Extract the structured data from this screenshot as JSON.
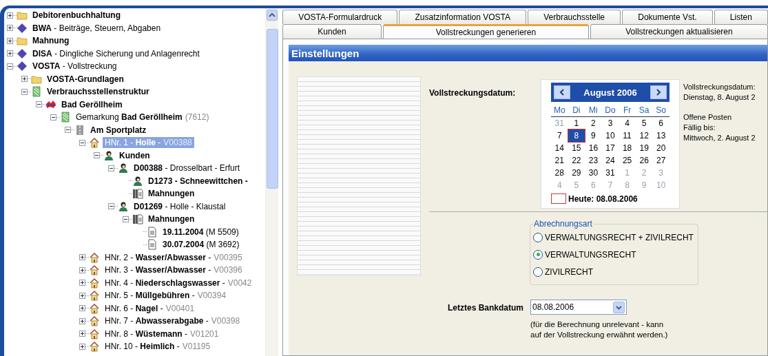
{
  "tree": {
    "items": [
      {
        "kind": "folder",
        "label": "Debitorenbuchhaltung",
        "bold": true,
        "expanded": false,
        "selected": false
      },
      {
        "kind": "diamond",
        "label": "**BWA** - Beiträge, Steuern, Abgaben",
        "expanded": false,
        "selected": false
      },
      {
        "kind": "folder",
        "label": "Mahnung",
        "bold": true,
        "expanded": false,
        "selected": false
      },
      {
        "kind": "diamond",
        "label": "**DISA** - Dingliche Sicherung und Anlagenrecht",
        "expanded": false,
        "selected": false
      },
      {
        "kind": "diamond",
        "label": "**VOSTA** - Vollstreckung",
        "expanded": true,
        "selected": false,
        "children": [
          {
            "kind": "folder",
            "label": "VOSTA-Grundlagen",
            "bold": true,
            "expanded": false,
            "selected": false
          },
          {
            "kind": "map",
            "label": "Verbrauchsstellenstruktur",
            "bold": true,
            "expanded": true,
            "selected": false,
            "children": [
              {
                "kind": "town",
                "label": "Bad Geröllheim",
                "bold": true,
                "expanded": true,
                "selected": false,
                "children": [
                  {
                    "kind": "map",
                    "label": "Gemarkung **Bad Geröllheim**",
                    "note": "(7612)",
                    "expanded": true,
                    "selected": false,
                    "children": [
                      {
                        "kind": "street",
                        "label": "Am Sportplatz",
                        "bold": true,
                        "expanded": true,
                        "selected": false,
                        "children": [
                          {
                            "kind": "house",
                            "label": "HNr. 1 - **Holle** -",
                            "note": "V00388",
                            "expanded": true,
                            "selected": true,
                            "children": [
                              {
                                "kind": "person",
                                "label": "Kunden",
                                "bold": true,
                                "expanded": true,
                                "selected": false,
                                "children": [
                                  {
                                    "kind": "person",
                                    "label": "**D00388** - Drosselbart - Erfurt",
                                    "expanded": true,
                                    "selected": false,
                                    "children": [
                                      {
                                        "kind": "person",
                                        "label": "D1273 - Schneewittchen -",
                                        "bold": true,
                                        "selected": false
                                      },
                                      {
                                        "kind": "docs",
                                        "label": "Mahnungen",
                                        "bold": true,
                                        "selected": false
                                      }
                                    ]
                                  },
                                  {
                                    "kind": "person",
                                    "label": "**D01269** - Holle - Klaustal",
                                    "expanded": true,
                                    "selected": false,
                                    "children": [
                                      {
                                        "kind": "docs",
                                        "label": "Mahnungen",
                                        "bold": true,
                                        "expanded": true,
                                        "selected": false,
                                        "children": [
                                          {
                                            "kind": "doc",
                                            "label": "**19.11.2004**  (M 5509)",
                                            "selected": false
                                          },
                                          {
                                            "kind": "doc",
                                            "label": "**30.07.2004**  (M 3692)",
                                            "selected": false
                                          }
                                        ]
                                      }
                                    ]
                                  }
                                ]
                              }
                            ]
                          },
                          {
                            "kind": "house",
                            "label": "HNr. 2 - **Wasser/Abwasser** -",
                            "note": "V00395",
                            "expanded": false,
                            "selected": false
                          },
                          {
                            "kind": "house",
                            "label": "HNr. 3 - **Wasser/Abwasser** -",
                            "note": "V00396",
                            "expanded": false,
                            "selected": false
                          },
                          {
                            "kind": "house",
                            "label": "HNr. 4 - **Niederschlagswasser** -",
                            "note": "V0042",
                            "expanded": false,
                            "selected": false
                          },
                          {
                            "kind": "house",
                            "label": "HNr. 5 - **Müllgebühren** -",
                            "note": "V00394",
                            "expanded": false,
                            "selected": false
                          },
                          {
                            "kind": "house",
                            "label": "HNr. 6 - **Nagel** -",
                            "note": "V00401",
                            "expanded": false,
                            "selected": false
                          },
                          {
                            "kind": "house",
                            "label": "HNr. 7 - **Abwasserabgabe** -",
                            "note": "V00398",
                            "expanded": false,
                            "selected": false
                          },
                          {
                            "kind": "house",
                            "label": "HNr. 8 - **Wüstemann** -",
                            "note": "V01201",
                            "expanded": false,
                            "selected": false
                          },
                          {
                            "kind": "house",
                            "label": "HNr. 10 - **Heimlich** -",
                            "note": "V01195",
                            "expanded": false,
                            "selected": false
                          }
                        ]
                      }
                    ]
                  }
                ]
              }
            ]
          }
        ]
      }
    ]
  },
  "tabs": [
    [
      {
        "label": "VOSTA-Formulardruck",
        "selected": false
      },
      {
        "label": "Zusatzinformation VOSTA",
        "selected": false
      },
      {
        "label": "Verbrauchsstelle",
        "selected": false
      },
      {
        "label": "Dokumente Vst.",
        "selected": false
      },
      {
        "label": "Listen",
        "selected": false
      }
    ],
    [
      {
        "label": "Kunden",
        "selected": false
      },
      {
        "label": "Vollstreckungen generieren",
        "selected": true
      },
      {
        "label": "Vollstreckungen aktualisieren",
        "selected": false
      }
    ]
  ],
  "settings": {
    "title": "Einstellungen",
    "date_label": "Vollstreckungsdatum:",
    "calendar": {
      "month": "August 2006",
      "weekdays": [
        "Mo",
        "Di",
        "Mi",
        "Do",
        "Fr",
        "Sa",
        "So"
      ],
      "weeks": [
        [
          {
            "day": "31",
            "other_month": true,
            "selected": false
          },
          {
            "day": "1",
            "other_month": false,
            "selected": false
          },
          {
            "day": "2",
            "other_month": false,
            "selected": false
          },
          {
            "day": "3",
            "other_month": false,
            "selected": false
          },
          {
            "day": "4",
            "other_month": false,
            "selected": false
          },
          {
            "day": "5",
            "other_month": false,
            "selected": false
          },
          {
            "day": "6",
            "other_month": false,
            "selected": false
          }
        ],
        [
          {
            "day": "7",
            "other_month": false,
            "selected": false
          },
          {
            "day": "8",
            "other_month": false,
            "selected": true
          },
          {
            "day": "9",
            "other_month": false,
            "selected": false
          },
          {
            "day": "10",
            "other_month": false,
            "selected": false
          },
          {
            "day": "11",
            "other_month": false,
            "selected": false
          },
          {
            "day": "12",
            "other_month": false,
            "selected": false
          },
          {
            "day": "13",
            "other_month": false,
            "selected": false
          }
        ],
        [
          {
            "day": "14",
            "other_month": false,
            "selected": false
          },
          {
            "day": "15",
            "other_month": false,
            "selected": false
          },
          {
            "day": "16",
            "other_month": false,
            "selected": false
          },
          {
            "day": "17",
            "other_month": false,
            "selected": false
          },
          {
            "day": "18",
            "other_month": false,
            "selected": false
          },
          {
            "day": "19",
            "other_month": false,
            "selected": false
          },
          {
            "day": "20",
            "other_month": false,
            "selected": false
          }
        ],
        [
          {
            "day": "21",
            "other_month": false,
            "selected": false
          },
          {
            "day": "22",
            "other_month": false,
            "selected": false
          },
          {
            "day": "23",
            "other_month": false,
            "selected": false
          },
          {
            "day": "24",
            "other_month": false,
            "selected": false
          },
          {
            "day": "25",
            "other_month": false,
            "selected": false
          },
          {
            "day": "26",
            "other_month": false,
            "selected": false
          },
          {
            "day": "27",
            "other_month": false,
            "selected": false
          }
        ],
        [
          {
            "day": "28",
            "other_month": false,
            "selected": false
          },
          {
            "day": "29",
            "other_month": false,
            "selected": false
          },
          {
            "day": "30",
            "other_month": false,
            "selected": false
          },
          {
            "day": "31",
            "other_month": false,
            "selected": false
          },
          {
            "day": "1",
            "other_month": true,
            "selected": false
          },
          {
            "day": "2",
            "other_month": true,
            "selected": false
          },
          {
            "day": "3",
            "other_month": true,
            "selected": false
          }
        ],
        [
          {
            "day": "4",
            "other_month": true,
            "selected": false
          },
          {
            "day": "5",
            "other_month": true,
            "selected": false
          },
          {
            "day": "6",
            "other_month": true,
            "selected": false
          },
          {
            "day": "7",
            "other_month": true,
            "selected": false
          },
          {
            "day": "8",
            "other_month": true,
            "selected": false
          },
          {
            "day": "9",
            "other_month": true,
            "selected": false
          },
          {
            "day": "10",
            "other_month": true,
            "selected": false
          }
        ]
      ],
      "today": "Heute: 08.08.2006"
    },
    "info": [
      [
        "Vollstreckungsdatum:",
        "Dienstag, 8. August 2"
      ],
      [
        "Offene Posten",
        "Fällig bis:",
        "Mittwoch, 2. August 2"
      ]
    ],
    "billing": {
      "title": "Abrechnungsart",
      "options": [
        {
          "label": "VERWALTUNGSRECHT + ZIVILRECHT",
          "selected": false
        },
        {
          "label": "VERWALTUNGSRECHT",
          "selected": true
        },
        {
          "label": "ZIVILRECHT",
          "selected": false
        }
      ]
    },
    "bank_date": {
      "label": "Letztes Bankdatum",
      "value": "08.08.2006",
      "hint": [
        "(für die Berechnung unrelevant - kann",
        "auf der Vollstreckung erwähnt werden.)"
      ]
    }
  }
}
